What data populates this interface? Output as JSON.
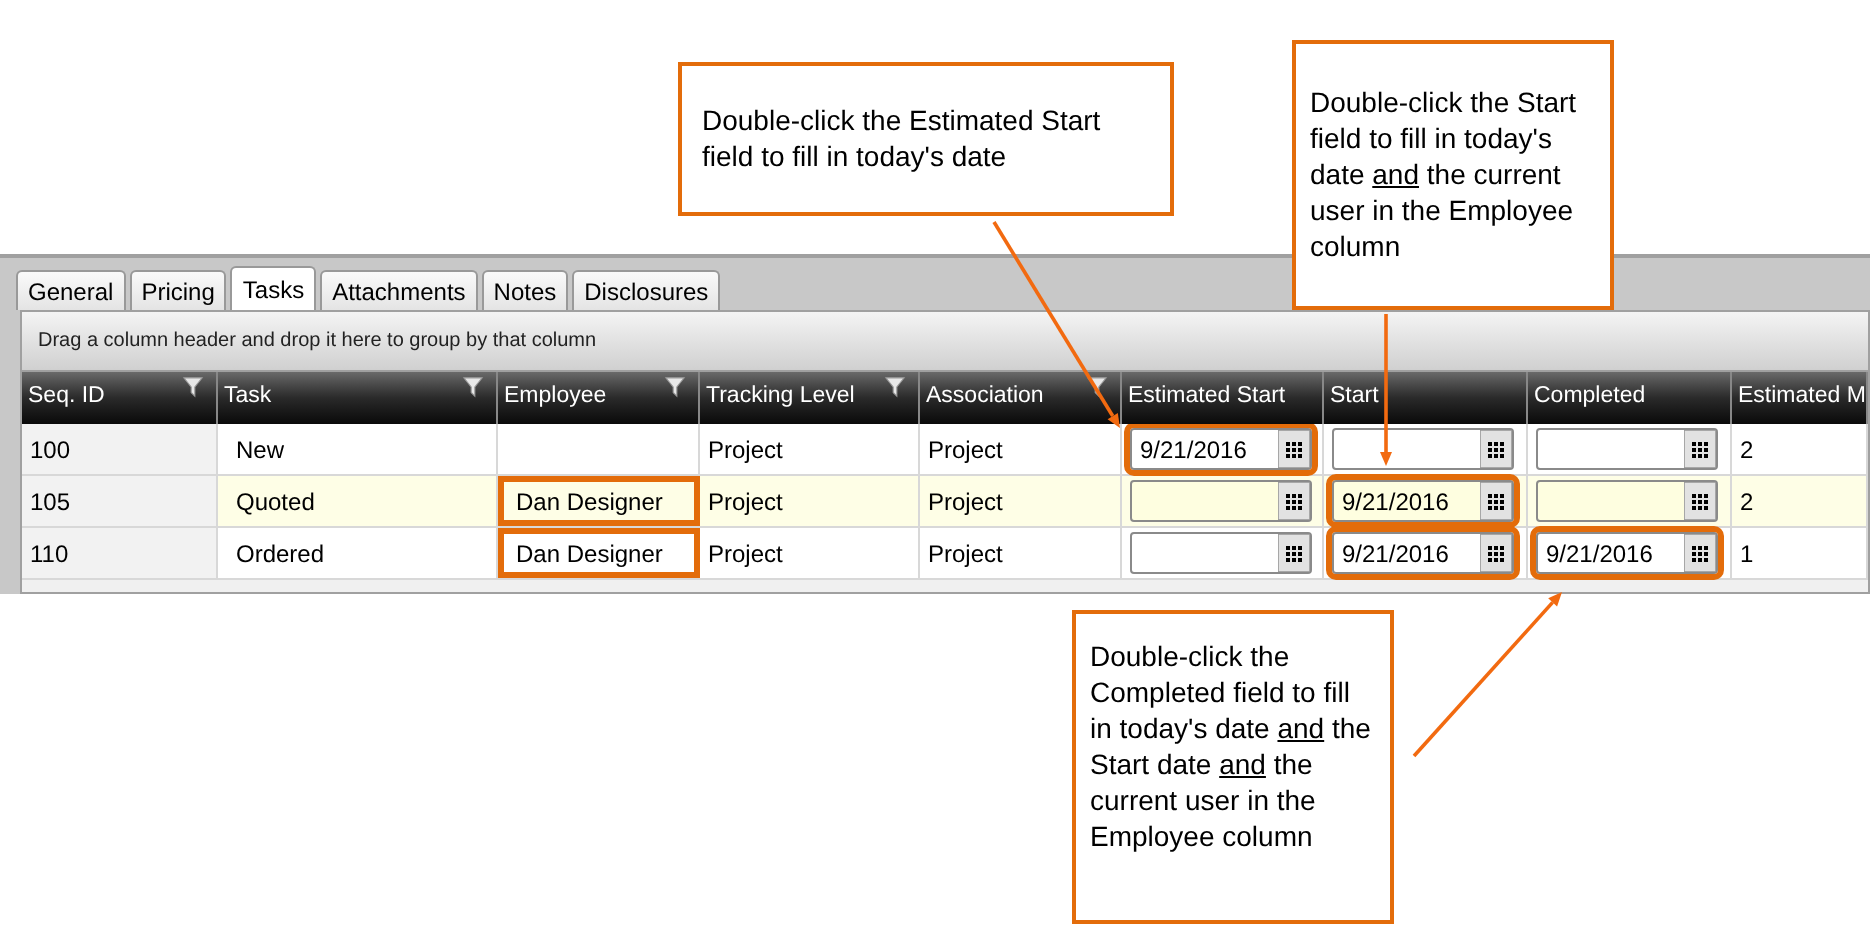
{
  "tabs": [
    {
      "label": "General",
      "selected": false
    },
    {
      "label": "Pricing",
      "selected": false
    },
    {
      "label": "Tasks",
      "selected": true
    },
    {
      "label": "Attachments",
      "selected": false
    },
    {
      "label": "Notes",
      "selected": false
    },
    {
      "label": "Disclosures",
      "selected": false
    }
  ],
  "group_panel": {
    "hint": "Drag a column header and drop it here to group by that column"
  },
  "table": {
    "columns": [
      {
        "label": "Seq. ID",
        "filter": true
      },
      {
        "label": "Task",
        "filter": true
      },
      {
        "label": "Employee",
        "filter": true
      },
      {
        "label": "Tracking Level",
        "filter": true
      },
      {
        "label": "Association",
        "filter": true
      },
      {
        "label": "Estimated Start",
        "filter": false
      },
      {
        "label": "Start",
        "filter": false
      },
      {
        "label": "Completed",
        "filter": false
      },
      {
        "label": "Estimated M",
        "filter": false
      }
    ],
    "rows": [
      {
        "shaded": false,
        "cells": [
          {
            "kind": "text",
            "value": "100",
            "highlighted": false
          },
          {
            "kind": "text",
            "value": "New",
            "highlighted": false
          },
          {
            "kind": "text",
            "highlighted": false
          },
          {
            "kind": "text",
            "value": "Project",
            "highlighted": false
          },
          {
            "kind": "text",
            "value": "Project",
            "highlighted": false
          },
          {
            "kind": "date",
            "value": "9/21/2016",
            "highlighted": true
          },
          {
            "kind": "date",
            "highlighted": false
          },
          {
            "kind": "date",
            "highlighted": false
          },
          {
            "kind": "text",
            "value": "2",
            "highlighted": false
          }
        ]
      },
      {
        "shaded": true,
        "cells": [
          {
            "kind": "text",
            "value": "105",
            "highlighted": false
          },
          {
            "kind": "text",
            "value": "Quoted",
            "highlighted": false
          },
          {
            "kind": "text",
            "value": "Dan Designer",
            "highlighted": true
          },
          {
            "kind": "text",
            "value": "Project",
            "highlighted": false
          },
          {
            "kind": "text",
            "value": "Project",
            "highlighted": false
          },
          {
            "kind": "date",
            "highlighted": false
          },
          {
            "kind": "date",
            "value": "9/21/2016",
            "highlighted": true
          },
          {
            "kind": "date",
            "highlighted": false
          },
          {
            "kind": "text",
            "value": "2",
            "highlighted": false
          }
        ]
      },
      {
        "shaded": false,
        "cells": [
          {
            "kind": "text",
            "value": "110",
            "highlighted": false
          },
          {
            "kind": "text",
            "value": "Ordered",
            "highlighted": false
          },
          {
            "kind": "text",
            "value": "Dan Designer",
            "highlighted": true
          },
          {
            "kind": "text",
            "value": "Project",
            "highlighted": false
          },
          {
            "kind": "text",
            "value": "Project",
            "highlighted": false
          },
          {
            "kind": "date",
            "highlighted": false
          },
          {
            "kind": "date",
            "value": "9/21/2016",
            "highlighted": true
          },
          {
            "kind": "date",
            "value": "9/21/2016",
            "highlighted": true
          },
          {
            "kind": "text",
            "value": "1",
            "highlighted": false
          }
        ]
      }
    ]
  },
  "callouts": [
    {
      "segments": [
        {
          "text": "Double-click the Estimated Start field to fill in today's date",
          "underlined": false
        }
      ]
    },
    {
      "segments": [
        {
          "text": "Double-click the Start field to fill in today's date ",
          "underlined": false
        },
        {
          "text": "and",
          "underlined": true
        },
        {
          "text": " the current user in the Employee column",
          "underlined": false
        }
      ]
    },
    {
      "segments": [
        {
          "text": "Double-click the Completed field to fill in today's date ",
          "underlined": false
        },
        {
          "text": "and",
          "underlined": true
        },
        {
          "text": " the Start date ",
          "underlined": false
        },
        {
          "text": "and",
          "underlined": true
        },
        {
          "text": " the current user in the Employee column",
          "underlined": false
        }
      ]
    }
  ]
}
